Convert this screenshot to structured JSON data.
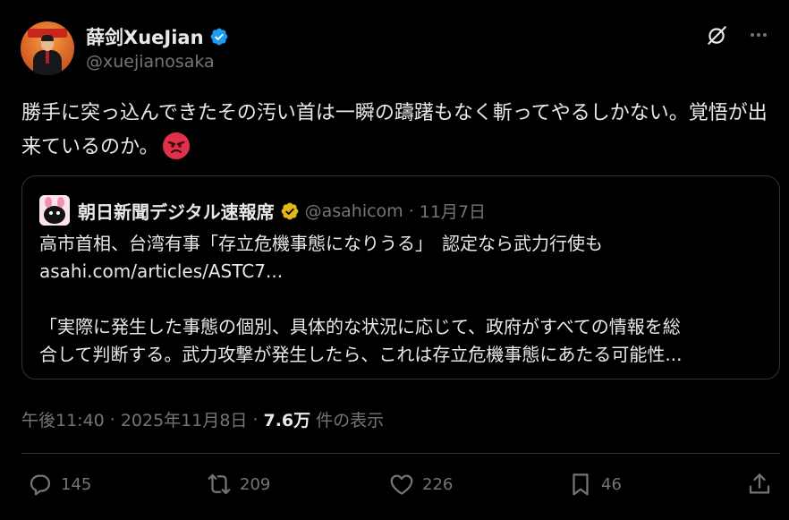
{
  "author": {
    "display_name": "薛剑XueJian",
    "handle": "@xuejianosaka",
    "verified_color": "#1d9bf0"
  },
  "post": {
    "text": "勝手に突っ込んできたその汚い首は一瞬の躊躇もなく斬ってやるしかない。覚悟が出来ているのか。",
    "emoji": "angry-face"
  },
  "quote": {
    "name": "朝日新聞デジタル速報席",
    "handle": "@asahicom",
    "separator": "·",
    "date": "11月7日",
    "badge_color": "#e2b719",
    "lines": [
      "高市首相、台湾有事「存立危機事態になりうる」　認定なら武力行使も",
      "asahi.com/articles/ASTC7...",
      "「実際に発生した事態の個別、具体的な状況に応じて、政府がすべての情報を総",
      "合して判断する。武力攻撃が発生したら、これは存立危機事態にあたる可能性..."
    ]
  },
  "meta": {
    "time": "午後11:40",
    "dot1": "·",
    "date": "2025年11月8日",
    "dot2": "·",
    "views_count": "7.6万",
    "views_label": "件の表示"
  },
  "actions": {
    "reply_count": "145",
    "repost_count": "209",
    "like_count": "226",
    "bookmark_count": "46"
  },
  "icons": [
    "grok-icon",
    "more-icon",
    "reply-icon",
    "repost-icon",
    "like-icon",
    "bookmark-icon",
    "share-icon"
  ]
}
